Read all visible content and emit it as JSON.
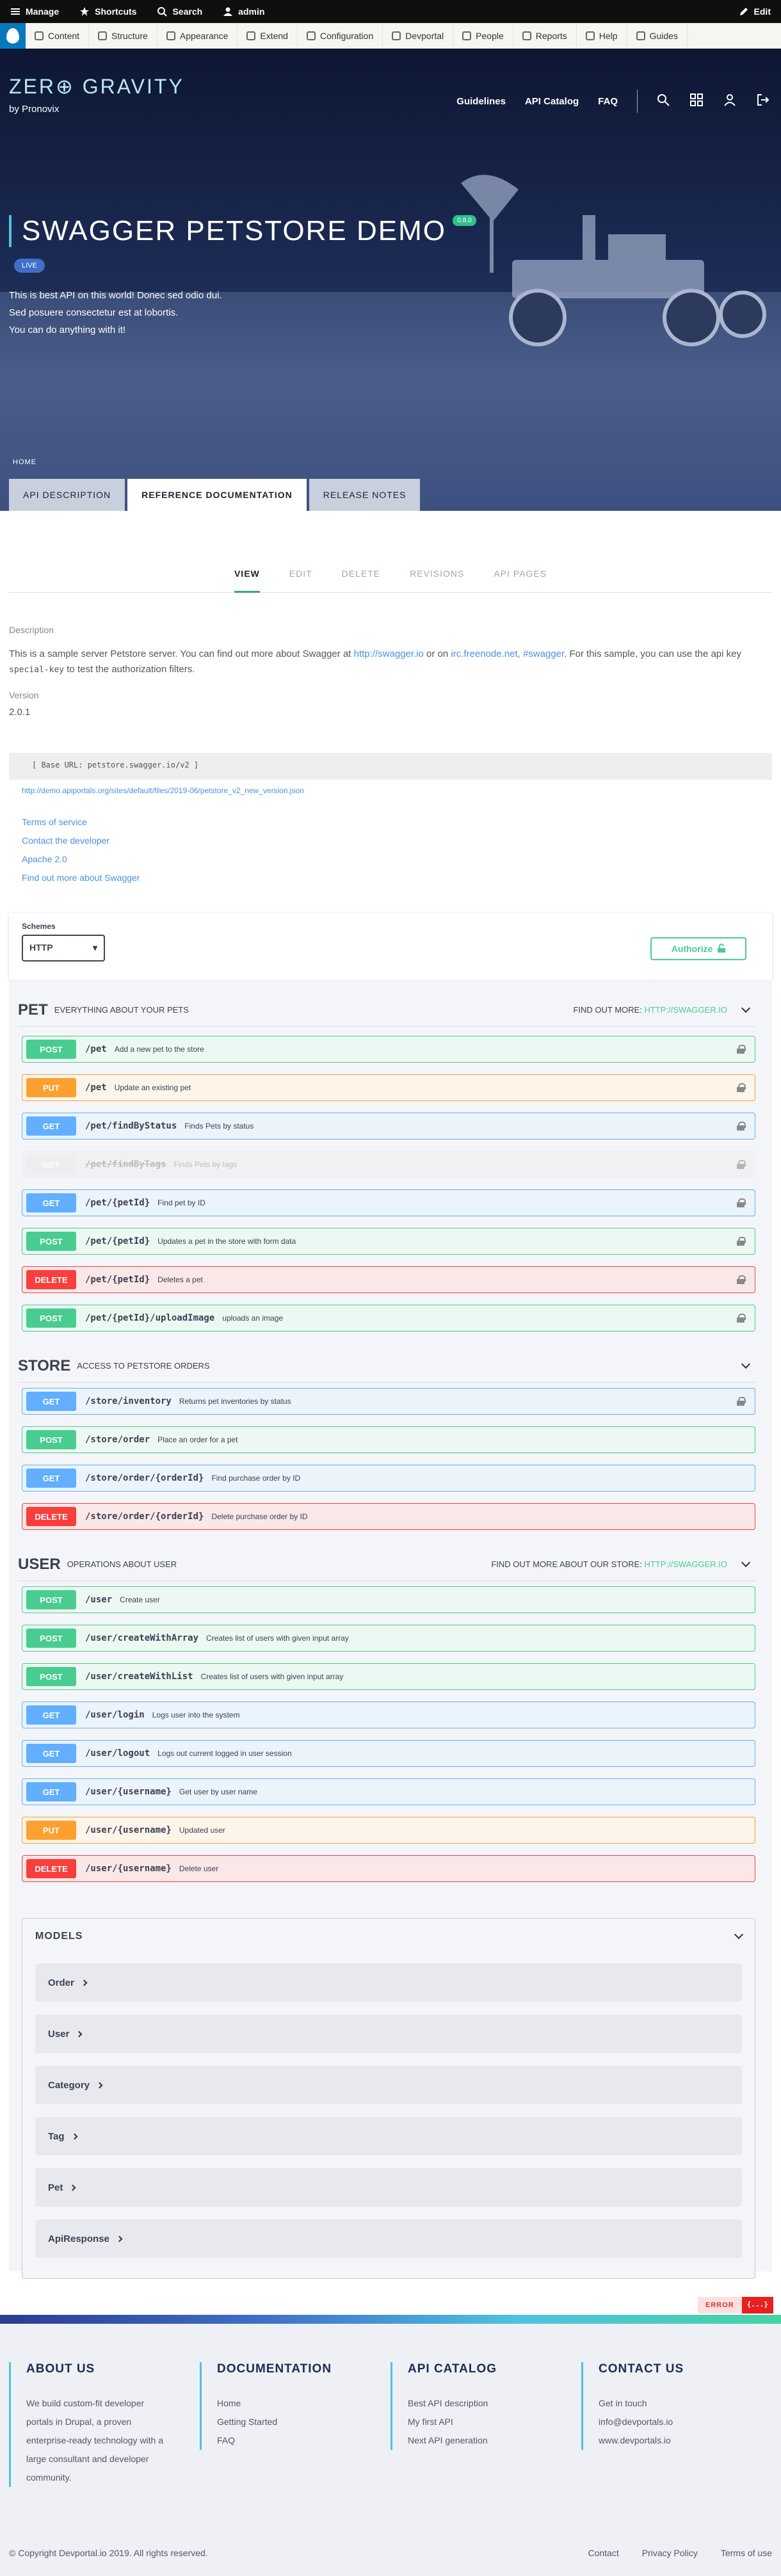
{
  "admin_bar": {
    "manage": "Manage",
    "shortcuts": "Shortcuts",
    "search": "Search",
    "user": "admin",
    "edit": "Edit"
  },
  "toolbar": {
    "items": [
      "Content",
      "Structure",
      "Appearance",
      "Extend",
      "Configuration",
      "Devportal",
      "People",
      "Reports",
      "Help",
      "Guides"
    ]
  },
  "header": {
    "logo": "ZER⊕ GRAVITY",
    "byline": "by Pronovix",
    "nav": [
      "Guidelines",
      "API Catalog",
      "FAQ"
    ]
  },
  "hero": {
    "title": "SWAGGER PETSTORE DEMO",
    "version_badge": "0.8.0",
    "status": "LIVE",
    "description": [
      "This is best API on this world! Donec sed odio dui.",
      "Sed posuere consectetur est at lobortis.",
      "You can do anything with it!"
    ],
    "breadcrumb": "HOME",
    "tabs": [
      "API DESCRIPTION",
      "REFERENCE DOCUMENTATION",
      "RELEASE NOTES"
    ]
  },
  "subnav": [
    "VIEW",
    "EDIT",
    "DELETE",
    "REVISIONS",
    "API PAGES"
  ],
  "content": {
    "description_label": "Description",
    "description_parts": {
      "a": "This is a sample server Petstore server. You can find out more about Swagger at ",
      "link1": "http://swagger.io",
      "b": " or on ",
      "link2": "irc.freenode.net, #swagger",
      "c": ". For this sample, you can use the api key ",
      "code": "special-key",
      "d": " to test the authorization filters."
    },
    "version_label": "Version",
    "version_value": "2.0.1",
    "base_url": "[ Base URL: petstore.swagger.io/v2 ]",
    "spec_link": "http://demo.apiportals.org/sites/default/files/2019-06/petstore_v2_new_version.json",
    "links": [
      "Terms of service",
      "Contact the developer",
      "Apache 2.0",
      "Find out more about Swagger"
    ]
  },
  "schemes": {
    "label": "Schemes",
    "selected": "HTTP",
    "authorize": "Authorize"
  },
  "tags": [
    {
      "name": "PET",
      "desc": "EVERYTHING ABOUT YOUR PETS",
      "more_label": "FIND OUT MORE:",
      "more_link": "HTTP://SWAGGER.IO"
    },
    {
      "name": "STORE",
      "desc": "ACCESS TO PETSTORE ORDERS",
      "more_label": "",
      "more_link": ""
    },
    {
      "name": "USER",
      "desc": "OPERATIONS ABOUT USER",
      "more_label": "FIND OUT MORE ABOUT OUR STORE:",
      "more_link": "HTTP://SWAGGER.IO"
    }
  ],
  "operations": [
    {
      "method": "POST",
      "path": "/pet",
      "desc": "Add a new pet to the store",
      "kind": "post",
      "lock": true
    },
    {
      "method": "PUT",
      "path": "/pet",
      "desc": "Update an existing pet",
      "kind": "put",
      "lock": true
    },
    {
      "method": "GET",
      "path": "/pet/findByStatus",
      "desc": "Finds Pets by status",
      "kind": "get",
      "lock": true
    },
    {
      "method": "GET",
      "path": "/pet/findByTags",
      "desc": "Finds Pets by tags",
      "kind": "deprecated",
      "lock": true
    },
    {
      "method": "GET",
      "path": "/pet/{petId}",
      "desc": "Find pet by ID",
      "kind": "get",
      "lock": true
    },
    {
      "method": "POST",
      "path": "/pet/{petId}",
      "desc": "Updates a pet in the store with form data",
      "kind": "post",
      "lock": true
    },
    {
      "method": "DELETE",
      "path": "/pet/{petId}",
      "desc": "Deletes a pet",
      "kind": "delete",
      "lock": true
    },
    {
      "method": "POST",
      "path": "/pet/{petId}/uploadImage",
      "desc": "uploads an image",
      "kind": "post",
      "lock": true
    },
    {
      "method": "GET",
      "path": "/store/inventory",
      "desc": "Returns pet inventories by status",
      "kind": "get",
      "lock": true
    },
    {
      "method": "POST",
      "path": "/store/order",
      "desc": "Place an order for a pet",
      "kind": "post",
      "lock": false
    },
    {
      "method": "GET",
      "path": "/store/order/{orderId}",
      "desc": "Find purchase order by ID",
      "kind": "get",
      "lock": false
    },
    {
      "method": "DELETE",
      "path": "/store/order/{orderId}",
      "desc": "Delete purchase order by ID",
      "kind": "delete",
      "lock": false
    },
    {
      "method": "POST",
      "path": "/user",
      "desc": "Create user",
      "kind": "post",
      "lock": false
    },
    {
      "method": "POST",
      "path": "/user/createWithArray",
      "desc": "Creates list of users with given input array",
      "kind": "post",
      "lock": false
    },
    {
      "method": "POST",
      "path": "/user/createWithList",
      "desc": "Creates list of users with given input array",
      "kind": "post",
      "lock": false
    },
    {
      "method": "GET",
      "path": "/user/login",
      "desc": "Logs user into the system",
      "kind": "get",
      "lock": false
    },
    {
      "method": "GET",
      "path": "/user/logout",
      "desc": "Logs out current logged in user session",
      "kind": "get",
      "lock": false
    },
    {
      "method": "GET",
      "path": "/user/{username}",
      "desc": "Get user by user name",
      "kind": "get",
      "lock": false
    },
    {
      "method": "PUT",
      "path": "/user/{username}",
      "desc": "Updated user",
      "kind": "put",
      "lock": false
    },
    {
      "method": "DELETE",
      "path": "/user/{username}",
      "desc": "Delete user",
      "kind": "delete",
      "lock": false
    }
  ],
  "models": {
    "title": "MODELS",
    "items": [
      "Order",
      "User",
      "Category",
      "Tag",
      "Pet",
      "ApiResponse"
    ]
  },
  "error_badge": {
    "label": "ERROR",
    "icon": "{...}"
  },
  "footer": {
    "about": {
      "title": "ABOUT US",
      "lines": [
        "We build custom-fit developer",
        "portals in Drupal, a proven",
        "enterprise-ready technology with a",
        "large consultant and developer",
        "community."
      ]
    },
    "docs": {
      "title": "DOCUMENTATION",
      "lines": [
        "Home",
        "Getting Started",
        "FAQ"
      ]
    },
    "catalog": {
      "title": "API CATALOG",
      "lines": [
        "Best API description",
        "My first API",
        "Next API generation"
      ]
    },
    "contact": {
      "title": "CONTACT US",
      "lines": [
        "Get in touch",
        "info@devportals.io",
        "www.devportals.io"
      ]
    },
    "copyright": "© Copyright Devportal.io 2019. All rights reserved.",
    "links": [
      "Contact",
      "Privacy Policy",
      "Terms of use"
    ]
  }
}
